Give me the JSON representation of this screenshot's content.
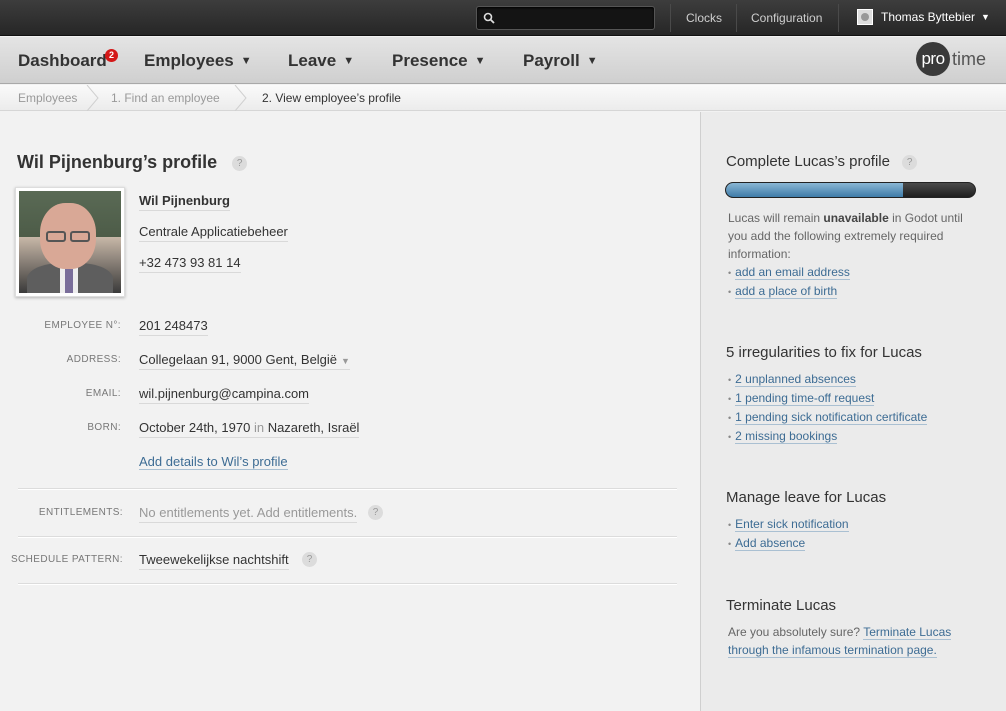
{
  "topbar": {
    "search_placeholder": "",
    "links": [
      "Clocks",
      "Configuration"
    ],
    "user_name": "Thomas Byttebier"
  },
  "nav": {
    "items": [
      {
        "label": "Dashboard",
        "badge": "2"
      },
      {
        "label": "Employees"
      },
      {
        "label": "Leave"
      },
      {
        "label": "Presence"
      },
      {
        "label": "Payroll"
      }
    ],
    "logo_pro": "pro",
    "logo_time": "time"
  },
  "breadcrumb": [
    "Employees",
    "1. Find an employee",
    "2. View employee’s profile"
  ],
  "profile": {
    "title": "Wil Pijnenburg’s profile",
    "name": "Wil Pijnenburg",
    "department": "Centrale Applicatiebeheer",
    "phone": "+32 473 93 81 14",
    "employee_no_label": "EMPLOYEE N°:",
    "employee_no": "201 248473",
    "address_label": "ADDRESS:",
    "address": "Collegelaan 91, 9000 Gent, België",
    "email_label": "EMAIL:",
    "email": "wil.pijnenburg@campina.com",
    "born_label": "BORN:",
    "born_date": "October 24th, 1970",
    "born_in": "in",
    "born_place": "Nazareth, Israël",
    "add_details": "Add details to Wil’s profile",
    "entitlements_label": "ENTITLEMENTS:",
    "entitlements": "No entitlements yet. Add entitlements.",
    "schedule_label": "SCHEDULE PATTERN:",
    "schedule": "Tweewekelijkse nachtshift"
  },
  "sidebar": {
    "complete": {
      "title": "Complete Lucas’s profile",
      "progress": 0.71,
      "text_pre": "Lucas will remain ",
      "text_bold": "unavailable",
      "text_post": " in Godot until you add the following extremely required information:",
      "items": [
        "add an email address",
        "add a place of birth"
      ]
    },
    "irregularities": {
      "title": "5 irregularities to fix for Lucas",
      "items": [
        "2 unplanned absences",
        "1 pending time-off request",
        "1 pending sick notification certificate",
        "2 missing bookings"
      ]
    },
    "leave": {
      "title": "Manage leave for Lucas",
      "items": [
        "Enter sick notification",
        "Add absence"
      ]
    },
    "terminate": {
      "title": "Terminate Lucas",
      "question": "Are you absolutely sure?",
      "link": "Terminate Lucas through the infamous termination page."
    }
  },
  "help_glyph": "?"
}
